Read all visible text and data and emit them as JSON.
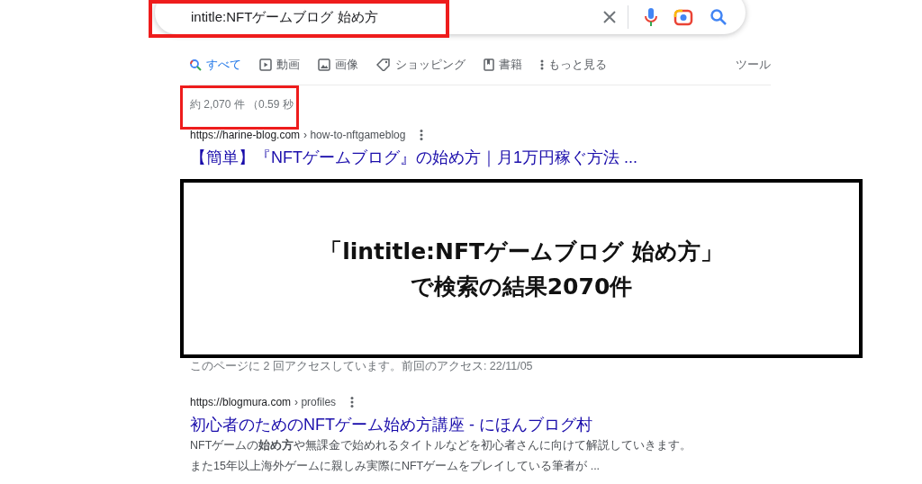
{
  "search": {
    "query": "intitle:NFTゲームブログ 始め方"
  },
  "tabs": [
    {
      "label": "すべて",
      "selected": true
    },
    {
      "label": "動画",
      "selected": false
    },
    {
      "label": "画像",
      "selected": false
    },
    {
      "label": "ショッピング",
      "selected": false
    },
    {
      "label": "書籍",
      "selected": false
    },
    {
      "label": "もっと見る",
      "selected": false
    }
  ],
  "tools": "ツール",
  "result_count": "約 2,070 件 （0.59 秒",
  "results": [
    {
      "site": "https://harine-blog.com",
      "path": "› how-to-nftgameblog",
      "title": "【簡単】『NFTゲームブログ』の始め方｜月1万円稼ぐ方法 ...",
      "visit_note": "このページに 2 回アクセスしています。前回のアクセス: 22/11/05"
    },
    {
      "site": "https://blogmura.com",
      "path": "› profiles",
      "title": "初心者のためのNFTゲーム始め方講座 - にほんブログ村",
      "snippet": [
        "NFTゲームの**始め方**や無課金で始めれるタイトルなどを初心者さんに向けて解説していきます。",
        "また15年以上海外ゲームに親しみ実際にNFTゲームをプレイしている筆者が ..."
      ]
    }
  ],
  "annotation": {
    "lines": [
      "「lintitle:NFTゲームブログ 始め方」",
      "で検索の結果2070件"
    ]
  }
}
